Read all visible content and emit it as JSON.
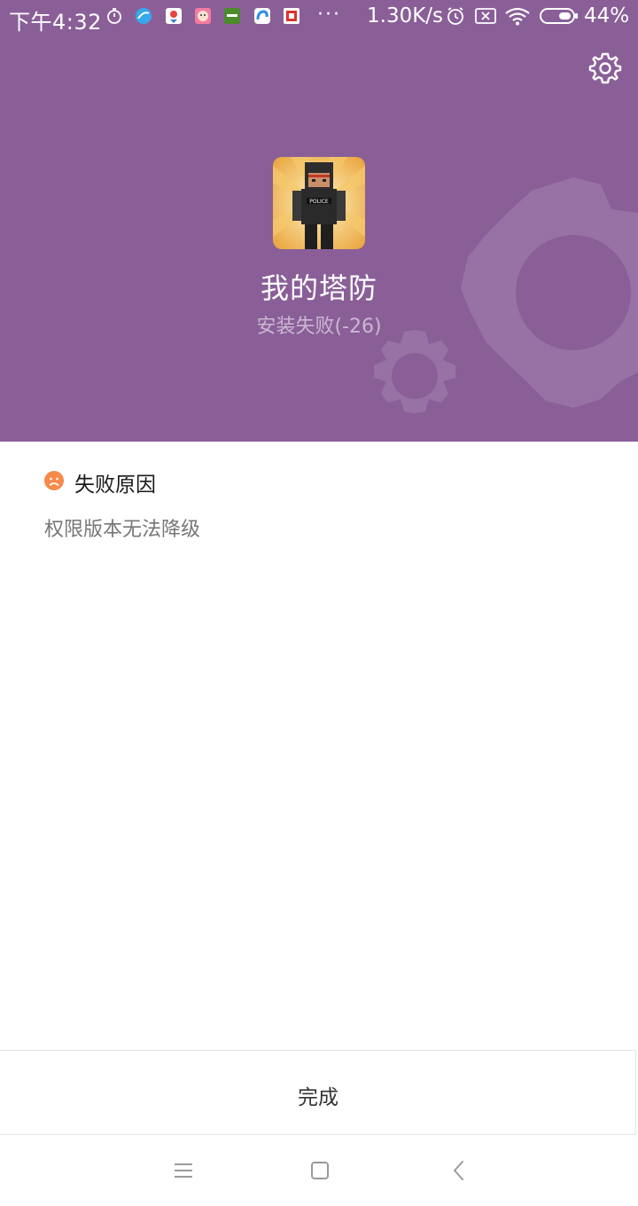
{
  "status_bar": {
    "time": "下午4:32",
    "notification_icons": [
      "stopwatch-icon",
      "blue-circle-app-icon",
      "map-pin-app-icon",
      "face-app-icon",
      "iherb-app-icon",
      "blue-swirl-app-icon",
      "red-grid-app-icon"
    ],
    "more": "···",
    "network_speed": "1.30K/s",
    "battery_percent": "44%"
  },
  "header": {
    "background_color": "#8a5f98",
    "app_name": "我的塔防",
    "install_status": "安装失败(-26)"
  },
  "failure": {
    "title": "失败原因",
    "reason": "权限版本无法降级",
    "icon_color": "#f58a4b"
  },
  "footer": {
    "done_label": "完成"
  },
  "nav_bar": {
    "buttons": [
      "menu-icon",
      "home-icon",
      "back-icon"
    ]
  }
}
